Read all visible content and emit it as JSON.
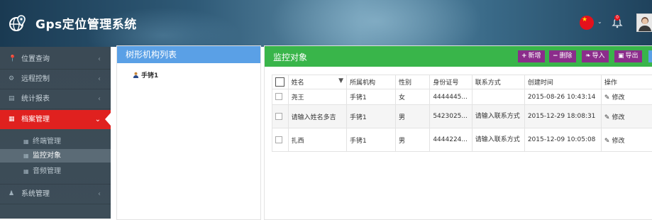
{
  "app": {
    "title": "Gps定位管理系统"
  },
  "header": {
    "flag_icon": "china-flag-icon",
    "notification_badge": "0"
  },
  "sidebar": {
    "items": [
      {
        "label": "位置查询",
        "icon": "map-marker-icon"
      },
      {
        "label": "远程控制",
        "icon": "gears-icon"
      },
      {
        "label": "统计报表",
        "icon": "bar-chart-icon"
      },
      {
        "label": "档案管理",
        "icon": "table-grid-icon",
        "active": true
      },
      {
        "label": "系统管理",
        "icon": "user-icon"
      }
    ],
    "subitems": [
      {
        "label": "终端管理"
      },
      {
        "label": "监控对象",
        "selected": true
      },
      {
        "label": "音频管理"
      }
    ]
  },
  "tree": {
    "title": "树形机构列表",
    "node": "手铐1"
  },
  "main": {
    "title": "监控对象",
    "buttons": {
      "add": "新增",
      "delete": "删除",
      "import": "导入",
      "export": "导出"
    },
    "columns": [
      "姓名",
      "所属机构",
      "性别",
      "身份证号",
      "联系方式",
      "创建时间",
      "操作"
    ],
    "rows": [
      {
        "name": "尧王",
        "org": "手铐1",
        "gender": "女",
        "id": "4444445...",
        "contact": "",
        "created": "2015-08-26 10:43:14",
        "action": "修改"
      },
      {
        "name": "请输入姓名多吉",
        "org": "手铐1",
        "gender": "男",
        "id": "5423025...",
        "contact": "请输入联系方式",
        "created": "2015-12-29 18:08:31",
        "action": "修改"
      },
      {
        "name": "扎西",
        "org": "手铐1",
        "gender": "男",
        "id": "4444224...",
        "contact": "请输入联系方式",
        "created": "2015-12-09 10:05:08",
        "action": "修改"
      }
    ]
  },
  "colors": {
    "active_nav": "#e0211f",
    "tree_header": "#5aa0e6",
    "main_header": "#39b54a",
    "toolbar_button": "#8b2d8b"
  }
}
